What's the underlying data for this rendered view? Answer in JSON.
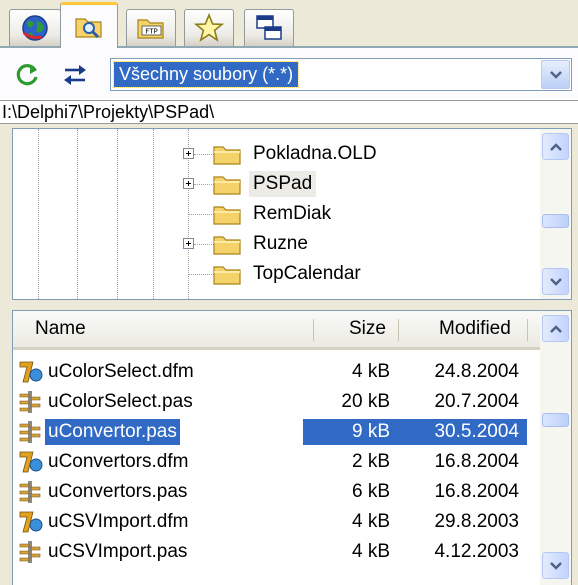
{
  "tabs": [
    {
      "icon": "globe-icon",
      "active": false
    },
    {
      "icon": "folder-search-icon",
      "active": true
    },
    {
      "icon": "ftp-icon",
      "active": false
    },
    {
      "icon": "star-icon",
      "active": false
    },
    {
      "icon": "windows-icon",
      "active": false
    }
  ],
  "filter": {
    "value": "Všechny soubory (*.*)"
  },
  "path": "I:\\Delphi7\\Projekty\\PSPad\\",
  "tree": {
    "items": [
      {
        "label": "Pokladna.OLD",
        "expandable": true,
        "selected": false
      },
      {
        "label": "PSPad",
        "expandable": true,
        "selected": true
      },
      {
        "label": "RemDiak",
        "expandable": false,
        "selected": false
      },
      {
        "label": "Ruzne",
        "expandable": true,
        "selected": false
      },
      {
        "label": "TopCalendar",
        "expandable": false,
        "selected": false
      }
    ]
  },
  "file_list": {
    "columns": {
      "name": "Name",
      "size": "Size",
      "modified": "Modified"
    },
    "rows": [
      {
        "name": "uColorSelect.dfm",
        "size": "4 kB",
        "modified": "24.8.2004",
        "type": "dfm",
        "selected": false
      },
      {
        "name": "uColorSelect.pas",
        "size": "20 kB",
        "modified": "20.7.2004",
        "type": "pas",
        "selected": false
      },
      {
        "name": "uConvertor.pas",
        "size": "9 kB",
        "modified": "30.5.2004",
        "type": "pas",
        "selected": true
      },
      {
        "name": "uConvertors.dfm",
        "size": "2 kB",
        "modified": "16.8.2004",
        "type": "dfm",
        "selected": false
      },
      {
        "name": "uConvertors.pas",
        "size": "6 kB",
        "modified": "16.8.2004",
        "type": "pas",
        "selected": false
      },
      {
        "name": "uCSVImport.dfm",
        "size": "4 kB",
        "modified": "29.8.2003",
        "type": "dfm",
        "selected": false
      },
      {
        "name": "uCSVImport.pas",
        "size": "4 kB",
        "modified": "4.12.2003",
        "type": "pas",
        "selected": false
      }
    ]
  },
  "colors": {
    "selection": "#316ac5",
    "tab_active_border": "#ffc83c",
    "folder": "#f5d36a",
    "refresh_green": "#2f9a2f",
    "scroll_blue": "#c3d3fd"
  }
}
